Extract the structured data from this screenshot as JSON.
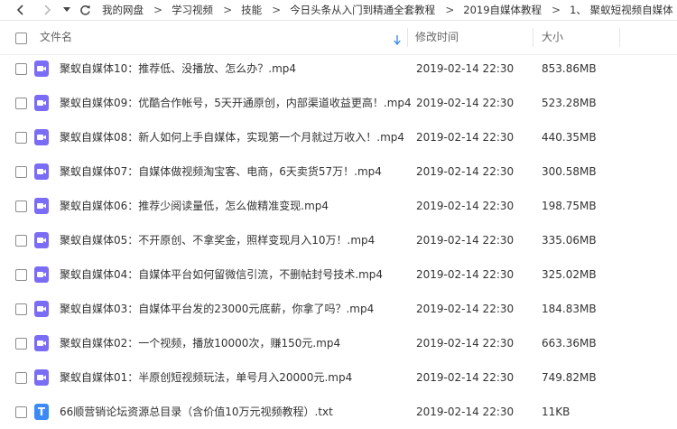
{
  "breadcrumbs": [
    "我的网盘",
    "学习视频",
    "技能",
    "今日头条从入门到精通全套教程",
    "2019自媒体教程",
    "1、 聚蚁短视频自媒体"
  ],
  "breadcrumb_separator": ">",
  "columns": {
    "name": "文件名",
    "modified": "修改时间",
    "size": "大小"
  },
  "txt_icon_letter": "T",
  "files": [
    {
      "name": "聚蚁自媒体10：推荐低、没播放、怎么办？.mp4",
      "modified": "2019-02-14 22:30",
      "size": "853.86MB",
      "type": "video"
    },
    {
      "name": "聚蚁自媒体09：优酷合作帐号，5天开通原创，内部渠道收益更高！.mp4",
      "modified": "2019-02-14 22:30",
      "size": "523.28MB",
      "type": "video"
    },
    {
      "name": "聚蚁自媒体08：新人如何上手自媒体，实现第一个月就过万收入！.mp4",
      "modified": "2019-02-14 22:30",
      "size": "440.35MB",
      "type": "video"
    },
    {
      "name": "聚蚁自媒体07：自媒体做视频淘宝客、电商，6天卖货57万！.mp4",
      "modified": "2019-02-14 22:30",
      "size": "300.58MB",
      "type": "video"
    },
    {
      "name": "聚蚁自媒体06：推荐少阅读量低，怎么做精准变现.mp4",
      "modified": "2019-02-14 22:30",
      "size": "198.75MB",
      "type": "video"
    },
    {
      "name": "聚蚁自媒体05：不开原创、不拿奖金，照样变现月入10万！.mp4",
      "modified": "2019-02-14 22:30",
      "size": "335.06MB",
      "type": "video"
    },
    {
      "name": "聚蚁自媒体04：自媒体平台如何留微信引流，不删帖封号技术.mp4",
      "modified": "2019-02-14 22:30",
      "size": "325.02MB",
      "type": "video"
    },
    {
      "name": "聚蚁自媒体03：自媒体平台发的23000元底薪，你拿了吗？.mp4",
      "modified": "2019-02-14 22:30",
      "size": "184.83MB",
      "type": "video"
    },
    {
      "name": "聚蚁自媒体02：一个视频，播放10000次，赚150元.mp4",
      "modified": "2019-02-14 22:30",
      "size": "663.36MB",
      "type": "video"
    },
    {
      "name": "聚蚁自媒体01：半原创短视频玩法，单号月入20000元.mp4",
      "modified": "2019-02-14 22:30",
      "size": "749.82MB",
      "type": "video"
    },
    {
      "name": "66顺营销论坛资源总目录（含价值10万元视频教程）.txt",
      "modified": "2019-02-14 22:30",
      "size": "11KB",
      "type": "txt"
    }
  ]
}
